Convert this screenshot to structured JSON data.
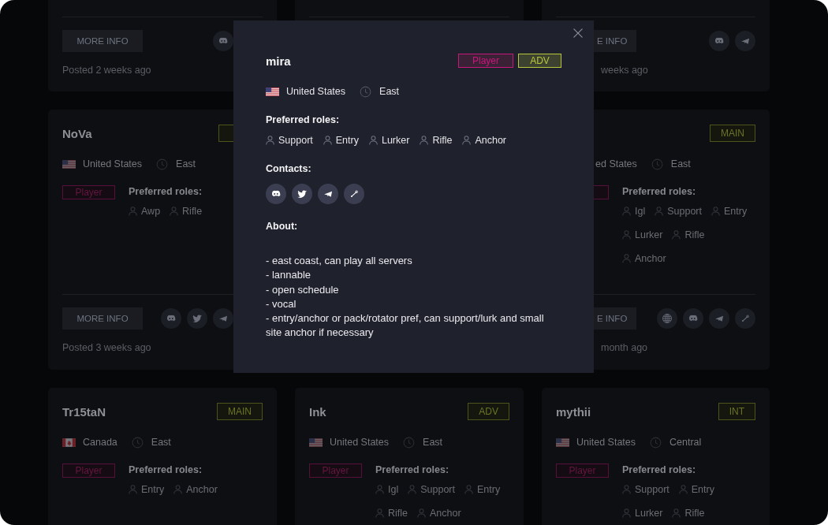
{
  "listings": [
    {
      "divider": true,
      "more_info": "MORE INFO",
      "contacts": [
        {
          "kind": "discord"
        }
      ],
      "posted": "Posted 2 weeks ago"
    },
    {
      "divider": true
    },
    {
      "divider": true,
      "more_info": "E INFO",
      "contacts": [
        {
          "kind": "discord"
        },
        {
          "kind": "telegram"
        }
      ],
      "posted": "weeks ago"
    },
    {
      "name": "NoVa",
      "level_badge_fragment": true,
      "location": {
        "flag": {
          "kind": "us"
        },
        "country": "United States",
        "region": "East"
      },
      "type_badge": "Player",
      "roles_heading": "Preferred roles:",
      "roles": [
        "Awp",
        "Rifle"
      ],
      "divider": true,
      "more_info": "MORE INFO",
      "contacts": [
        {
          "kind": "discord"
        },
        {
          "kind": "twitter"
        },
        {
          "kind": "telegram"
        }
      ],
      "posted": "Posted 3 weeks ago"
    },
    {
      "level_badge": "MAIN",
      "location": {
        "country": "ed States",
        "region": "East"
      },
      "type_badge_fragment": true,
      "roles_heading": "Preferred roles:",
      "roles": [
        "Igl",
        "Support",
        "Entry",
        "Lurker",
        "Rifle",
        "Anchor"
      ],
      "divider": true,
      "more_info": "E INFO",
      "contacts": [
        {
          "kind": "globe"
        },
        {
          "kind": "discord"
        },
        {
          "kind": "telegram"
        },
        {
          "kind": "steam"
        }
      ],
      "posted": "month ago"
    },
    {
      "name": "Tr15taN",
      "level_badge": "MAIN",
      "location": {
        "flag": {
          "kind": "ca"
        },
        "country": "Canada",
        "region": "East"
      },
      "type_badge": "Player",
      "roles_heading": "Preferred roles:",
      "roles": [
        "Entry",
        "Anchor"
      ]
    },
    {
      "name": "Ink",
      "level_badge": "ADV",
      "location": {
        "flag": {
          "kind": "us"
        },
        "country": "United States",
        "region": "East"
      },
      "type_badge": "Player",
      "roles_heading": "Preferred roles:",
      "roles": [
        "Igl",
        "Support",
        "Entry",
        "Rifle",
        "Anchor"
      ]
    },
    {
      "name": "mythii",
      "level_badge": "INT",
      "location": {
        "flag": {
          "kind": "us"
        },
        "country": "United States",
        "region": "Central"
      },
      "type_badge": "Player",
      "roles_heading": "Preferred roles:",
      "roles": [
        "Support",
        "Entry",
        "Lurker",
        "Rifle"
      ]
    }
  ],
  "dialog": {
    "name": "mira",
    "type_badge": "Player",
    "level_badge": "ADV",
    "location": {
      "flag": {
        "kind": "us"
      },
      "country": "United States",
      "region": "East"
    },
    "roles_heading": "Preferred roles:",
    "roles": [
      "Support",
      "Entry",
      "Lurker",
      "Rifle",
      "Anchor"
    ],
    "contacts_heading": "Contacts:",
    "contacts": [
      {
        "kind": "discord"
      },
      {
        "kind": "twitter"
      },
      {
        "kind": "telegram"
      },
      {
        "kind": "steam"
      }
    ],
    "about_heading": "About:",
    "about": "- east coast, can play all servers\n- lannable\n- open schedule\n- vocal\n- entry/anchor or pack/rotator pref, can support/lurk and small site anchor if necessary"
  }
}
